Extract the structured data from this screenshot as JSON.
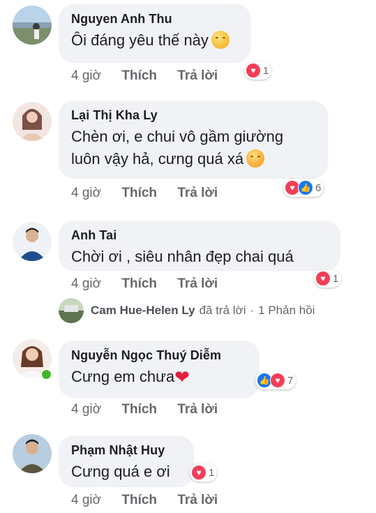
{
  "comments": [
    {
      "name": "Nguyen Anh Thu",
      "text": "Ôi đáng yêu thế này",
      "time": "4 giờ",
      "like": "Thích",
      "reply": "Trả lời",
      "reaction_count": "1"
    },
    {
      "name": "Lại Thị Kha Ly",
      "text_line1": "Chèn ơi, e chui vô gầm giường",
      "text_line2": "luôn vậy hả, cưng quá xá",
      "time": "4 giờ",
      "like": "Thích",
      "reply": "Trả lời",
      "reaction_count": "6"
    },
    {
      "name": "Anh Tai",
      "text": "Chời ơi , siêu nhân đẹp chai quá",
      "time": "4 giờ",
      "like": "Thích",
      "reply": "Trả lời",
      "reaction_count": "1"
    },
    {
      "name": "Nguyễn Ngọc Thuý Diễm",
      "text": "Cưng em chưa",
      "time": "4 giờ",
      "like": "Thích",
      "reply": "Trả lời",
      "reaction_count": "7"
    },
    {
      "name": "Phạm Nhật Huy",
      "text": "Cưng quá e ơi",
      "time": "4 giờ",
      "like": "Thích",
      "reply": "Trả lời",
      "reaction_count": "1"
    }
  ],
  "reply_thread": {
    "name": "Cam Hue-Helen Ly",
    "action": "đã trả lời",
    "separator": "·",
    "count": "1 Phản hồi"
  },
  "icons": {
    "love": "heart-icon",
    "like": "thumbs-up-icon"
  },
  "colors": {
    "bubble": "#f0f2f5",
    "love": "#f33e58",
    "like": "#1877f2",
    "online": "#42b72a"
  }
}
